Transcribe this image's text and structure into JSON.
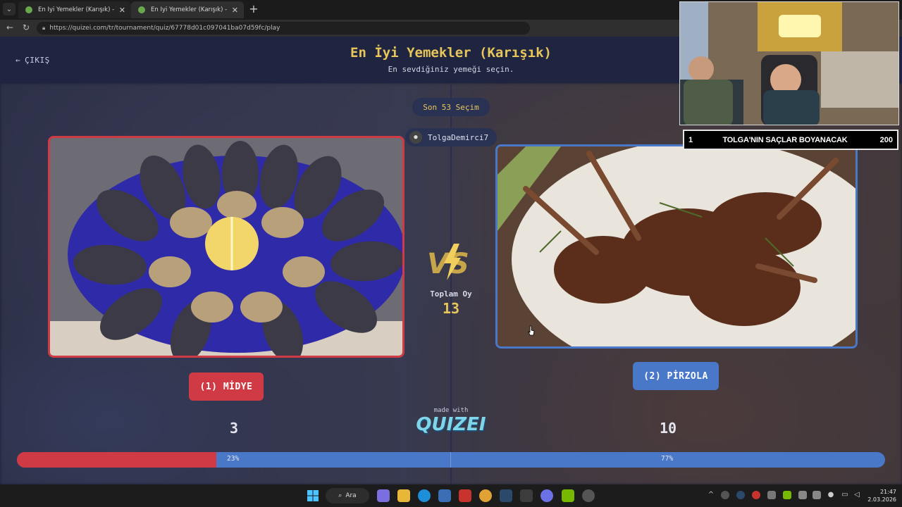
{
  "browser": {
    "tabs": [
      {
        "title": "En İyi Yemekler (Karışık) - Tier List"
      },
      {
        "title": "En İyi Yemekler (Karışık) - Tier List"
      }
    ],
    "url": "https://quizei.com/tr/tournament/quiz/67778d01c097041ba07d59fc/play"
  },
  "header": {
    "exit_label": "ÇIKIŞ",
    "title": "En İyi Yemekler (Karışık)",
    "subtitle": "En sevdiğiniz yemeği seçin."
  },
  "round": {
    "label": "Son 53 Seçim",
    "user": "TolgaDemirci7"
  },
  "left_option": {
    "label": "(1) MİDYE",
    "votes": "3",
    "percent_label": "23%",
    "percent": 23,
    "color": "#d03a44"
  },
  "right_option": {
    "label": "(2) PİRZOLA",
    "votes": "10",
    "percent_label": "77%",
    "percent": 77,
    "color": "#4a78c9"
  },
  "totals": {
    "label": "Toplam Oy",
    "value": "13"
  },
  "branding": {
    "made_with": "made with",
    "logo": "QUIZEI"
  },
  "overlay": {
    "rank": "1",
    "message": "TOLGA'NIN SAÇLAR BOYANACAK",
    "points": "200"
  },
  "taskbar": {
    "search_label": "Ara",
    "time": "21:47",
    "date": "2.03.2026"
  },
  "colors": {
    "accent_gold": "#e8c65a",
    "header_bg": "#1f2540"
  }
}
